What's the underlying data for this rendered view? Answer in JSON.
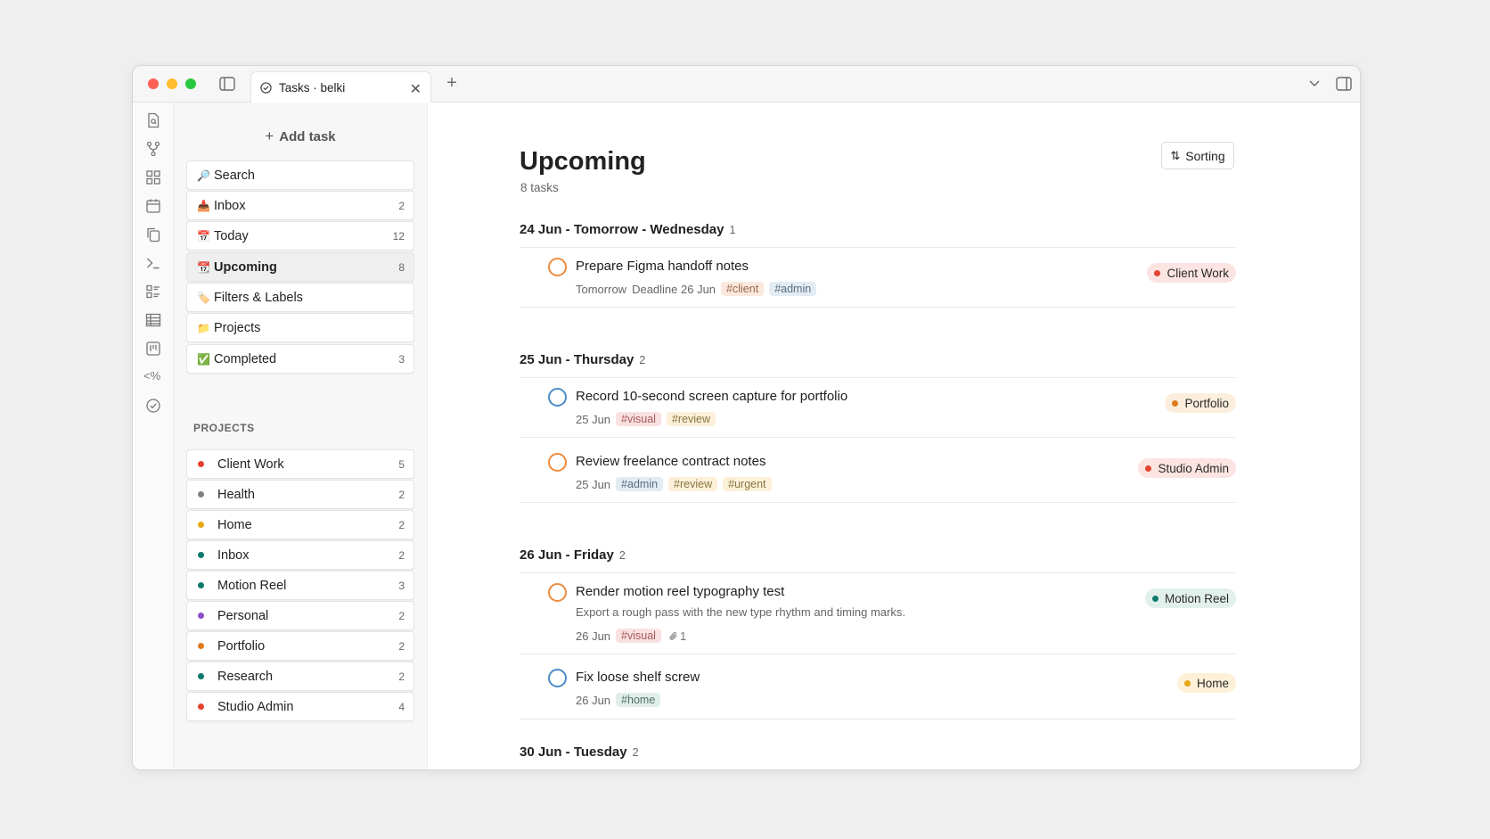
{
  "titlebar": {
    "tab_title": "Tasks · belki",
    "tab_close": "✕",
    "new_tab": "+"
  },
  "sidebar": {
    "add_task": "Add task",
    "add_task_icon": "+",
    "nav": [
      {
        "emoji": "🔎",
        "label": "Search",
        "count": ""
      },
      {
        "emoji": "📥",
        "label": "Inbox",
        "count": "2"
      },
      {
        "emoji": "📅",
        "label": "Today",
        "count": "12"
      },
      {
        "emoji": "📆",
        "label": "Upcoming",
        "count": "8"
      },
      {
        "emoji": "🏷️",
        "label": "Filters & Labels",
        "count": ""
      },
      {
        "emoji": "📁",
        "label": "Projects",
        "count": ""
      },
      {
        "emoji": "✅",
        "label": "Completed",
        "count": "3"
      }
    ],
    "projects_heading": "PROJECTS",
    "projects": [
      {
        "label": "Client Work",
        "count": "5",
        "color": "#e44332"
      },
      {
        "label": "Health",
        "count": "2",
        "color": "#808080"
      },
      {
        "label": "Home",
        "count": "2",
        "color": "#e8a712"
      },
      {
        "label": "Inbox",
        "count": "2",
        "color": "#0f7b6c"
      },
      {
        "label": "Motion Reel",
        "count": "3",
        "color": "#0f7b6c"
      },
      {
        "label": "Personal",
        "count": "2",
        "color": "#8a4fc9"
      },
      {
        "label": "Portfolio",
        "count": "2",
        "color": "#e07b1d"
      },
      {
        "label": "Research",
        "count": "2",
        "color": "#0f7b6c"
      },
      {
        "label": "Studio Admin",
        "count": "4",
        "color": "#e44332"
      }
    ]
  },
  "main": {
    "title": "Upcoming",
    "task_count": "8 tasks",
    "sort_label": "Sorting",
    "sort_icon": "⇅",
    "groups": [
      {
        "header": "24 Jun - Tomorrow - Wednesday",
        "count": "1",
        "tasks": [
          {
            "title": "Prepare Figma handoff notes",
            "meta": [
              "Tomorrow",
              "Deadline 26 Jun"
            ],
            "tags": [
              "#client",
              "#admin"
            ],
            "project": "Client Work"
          }
        ]
      },
      {
        "header": "25 Jun - Thursday",
        "count": "2",
        "tasks": [
          {
            "title": "Record 10-second screen capture for portfolio",
            "meta": [
              "25 Jun"
            ],
            "tags": [
              "#visual",
              "#review"
            ],
            "project": "Portfolio"
          },
          {
            "title": "Review freelance contract notes",
            "meta": [
              "25 Jun"
            ],
            "tags": [
              "#admin",
              "#review",
              "#urgent"
            ],
            "project": "Studio Admin"
          }
        ]
      },
      {
        "header": "26 Jun - Friday",
        "count": "2",
        "tasks": [
          {
            "title": "Render motion reel typography test",
            "description": "Export a rough pass with the new type rhythm and timing marks.",
            "meta": [
              "26 Jun"
            ],
            "tags": [
              "#visual"
            ],
            "attachments": "1",
            "project": "Motion Reel"
          },
          {
            "title": "Fix loose shelf screw",
            "meta": [
              "26 Jun"
            ],
            "tags": [
              "#home"
            ],
            "project": "Home"
          }
        ]
      },
      {
        "header": "30 Jun - Tuesday",
        "count": "2",
        "tasks": []
      }
    ]
  },
  "colors": {
    "accent_red": "#e44332",
    "check_orange": "#ef8b3c",
    "check_blue": "#4a8cc9"
  }
}
